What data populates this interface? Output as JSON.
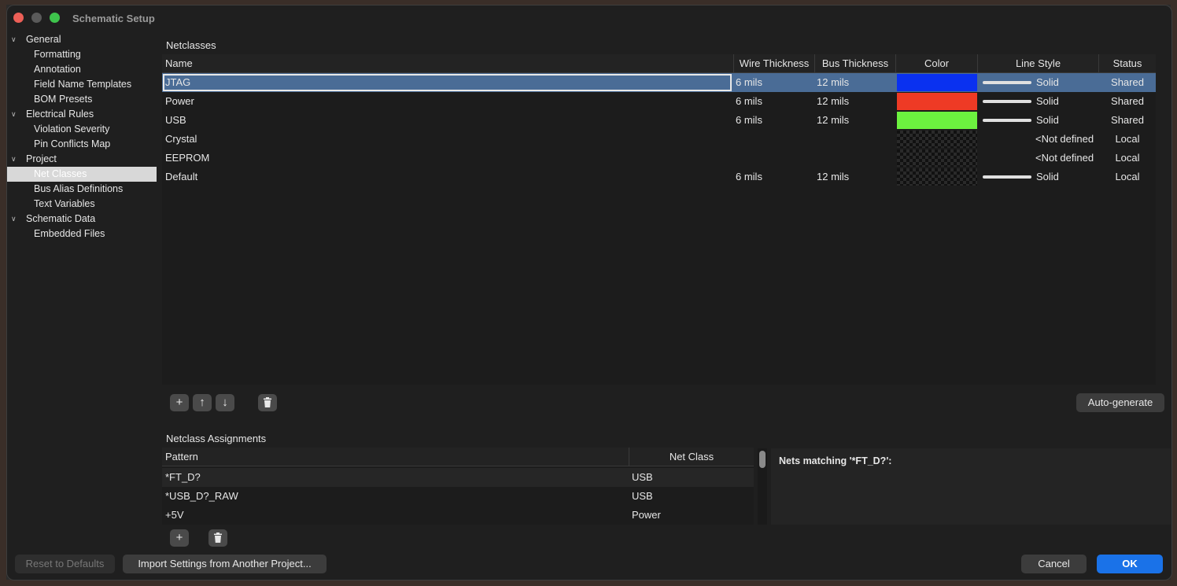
{
  "window": {
    "title": "Schematic Setup"
  },
  "tree": [
    {
      "label": "General",
      "level": 0,
      "expanded": true
    },
    {
      "label": "Formatting",
      "level": 1
    },
    {
      "label": "Annotation",
      "level": 1
    },
    {
      "label": "Field Name Templates",
      "level": 1
    },
    {
      "label": "BOM Presets",
      "level": 1
    },
    {
      "label": "Electrical Rules",
      "level": 0,
      "expanded": true
    },
    {
      "label": "Violation Severity",
      "level": 1
    },
    {
      "label": "Pin Conflicts Map",
      "level": 1
    },
    {
      "label": "Project",
      "level": 0,
      "expanded": true
    },
    {
      "label": "Net Classes",
      "level": 1,
      "selected": true
    },
    {
      "label": "Bus Alias Definitions",
      "level": 1
    },
    {
      "label": "Text Variables",
      "level": 1
    },
    {
      "label": "Schematic Data",
      "level": 0,
      "expanded": true
    },
    {
      "label": "Embedded Files",
      "level": 1
    }
  ],
  "netclasses": {
    "title": "Netclasses",
    "headers": {
      "name": "Name",
      "wire": "Wire Thickness",
      "bus": "Bus Thickness",
      "color": "Color",
      "line_style": "Line Style",
      "status": "Status"
    },
    "rows": [
      {
        "name": "JTAG",
        "wire": "6 mils",
        "bus": "12 mils",
        "color": "#0a31f0",
        "line_style": "Solid",
        "status": "Shared",
        "selected": true
      },
      {
        "name": "Power",
        "wire": "6 mils",
        "bus": "12 mils",
        "color": "#ee3a25",
        "line_style": "Solid",
        "status": "Shared"
      },
      {
        "name": "USB",
        "wire": "6 mils",
        "bus": "12 mils",
        "color": "#6cf23f",
        "line_style": "Solid",
        "status": "Shared"
      },
      {
        "name": "Crystal",
        "wire": "",
        "bus": "",
        "color": "checker",
        "line_style": "<Not defined",
        "status": "Local"
      },
      {
        "name": "EEPROM",
        "wire": "",
        "bus": "",
        "color": "checker",
        "line_style": "<Not defined",
        "status": "Local"
      },
      {
        "name": "Default",
        "wire": "6 mils",
        "bus": "12 mils",
        "color": "checker",
        "line_style": "Solid",
        "status": "Local"
      }
    ],
    "auto_generate": "Auto-generate"
  },
  "assignments": {
    "title": "Netclass Assignments",
    "headers": {
      "pattern": "Pattern",
      "net_class": "Net Class"
    },
    "rows": [
      {
        "pattern": "*FT_D?",
        "net_class": "USB"
      },
      {
        "pattern": "*USB_D?_RAW",
        "net_class": "USB"
      },
      {
        "pattern": "+5V",
        "net_class": "Power"
      }
    ],
    "matches_title": "Nets matching '*FT_D?':"
  },
  "footer": {
    "reset": "Reset to Defaults",
    "import": "Import Settings from Another Project...",
    "cancel": "Cancel",
    "ok": "OK"
  },
  "colors": {
    "selection": "#4a6c96",
    "accent": "#1a72e8"
  }
}
